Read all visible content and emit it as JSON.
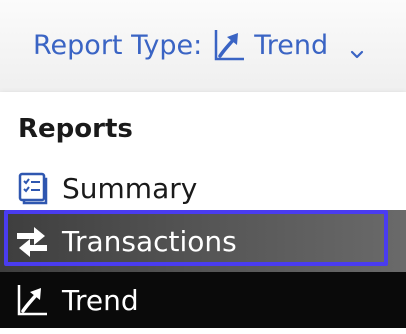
{
  "report_type_select": {
    "label": "Report Type:",
    "value": "Trend",
    "value_icon": "trend-icon",
    "chevron_icon": "chevron-down-icon",
    "accent_color": "#3a64c4"
  },
  "menu": {
    "group_heading": "Reports",
    "items": [
      {
        "label": "Summary",
        "icon": "summary-icon",
        "state": "default"
      },
      {
        "label": "Transactions",
        "icon": "transactions-icon",
        "state": "hovered-focused"
      },
      {
        "label": "Trend",
        "icon": "trend-icon",
        "state": "selected"
      }
    ],
    "focus_color": "#4a3cf0"
  }
}
